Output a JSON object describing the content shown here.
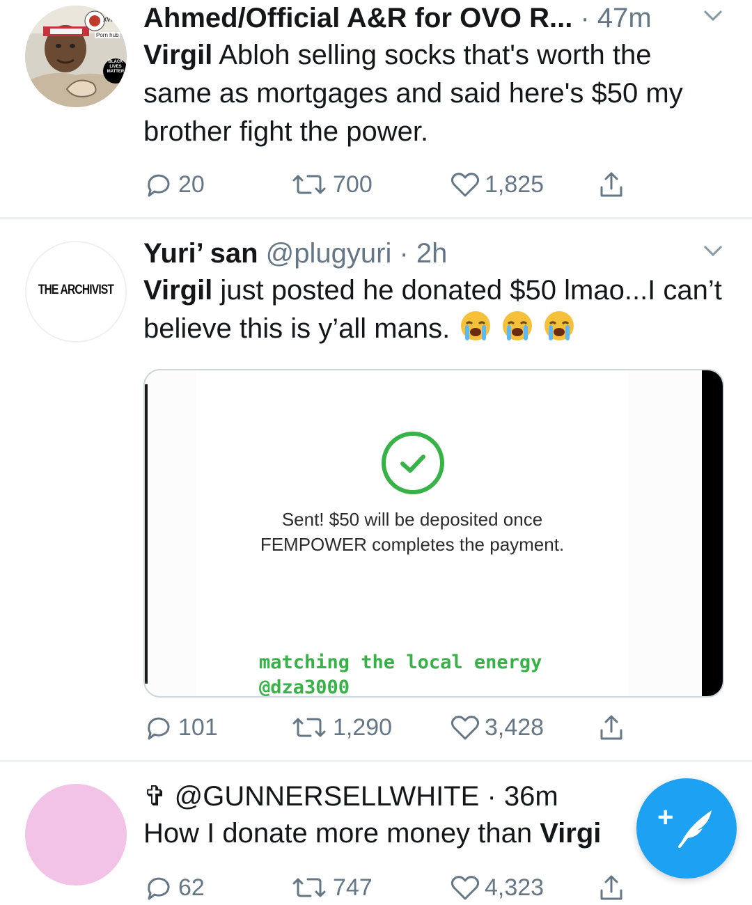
{
  "tweets": [
    {
      "display_name": "Ahmed/Official A&R for OVO R...",
      "meta": " · 47m",
      "text_bold": "Virgil",
      "text": " Abloh selling socks that's worth the same as mortgages and said here's $50 my brother fight the power.",
      "avatar_badges": [
        "XVIDS",
        "Porn hub",
        "BLACK LIVES MATTER"
      ],
      "replies": "20",
      "retweets": "700",
      "likes": "1,825"
    },
    {
      "display_name": "Yuri’ san",
      "meta": " @plugyuri · 2h",
      "avatar_text": "THE ARCHIVIST",
      "text_bold": "Virgil",
      "text": " just posted he donated $50 lmao...I can’t believe this is y’all mans.",
      "emoji": "loudly-crying-face",
      "media": {
        "sent_line1": "Sent! $50 will be deposited once",
        "sent_line2": "FEMPOWER completes the payment.",
        "caption_line1": "matching the local energy",
        "caption_line2": "@dza3000",
        "accent": "#36b247"
      },
      "replies": "101",
      "retweets": "1,290",
      "likes": "3,428"
    },
    {
      "display_name": "✞",
      "meta": " @GUNNERSELLWHITE · 36m",
      "text_plain": "How I donate more money than ",
      "text_bold": "Virgi",
      "avatar_color": "#f2c3e6",
      "replies": "62",
      "retweets": "747",
      "likes": "4,323"
    }
  ],
  "compose_button": {
    "label": "+",
    "color": "#1da1f2"
  },
  "colors": {
    "text": "#14171a",
    "muted": "#657786",
    "divider": "#e6ecf0"
  }
}
